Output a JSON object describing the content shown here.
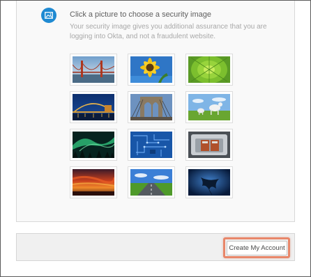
{
  "security": {
    "title": "Click a picture to choose a security image",
    "description": "Your security image gives you additional assurance that you are logging into Okta, and not a fraudulent website.",
    "icon": "image-icon",
    "accent_color": "#1f8ad2"
  },
  "images": [
    {
      "name": "golden-gate-bridge"
    },
    {
      "name": "sunflower"
    },
    {
      "name": "green-leaf"
    },
    {
      "name": "bridge-at-night"
    },
    {
      "name": "brooklyn-bridge"
    },
    {
      "name": "goats-in-field"
    },
    {
      "name": "northern-lights"
    },
    {
      "name": "circuit-board"
    },
    {
      "name": "tea-kettle"
    },
    {
      "name": "sunset-sky"
    },
    {
      "name": "road"
    },
    {
      "name": "manta-ray"
    }
  ],
  "footer": {
    "create_label": "Create My Account",
    "highlight_color": "#e8876a"
  }
}
